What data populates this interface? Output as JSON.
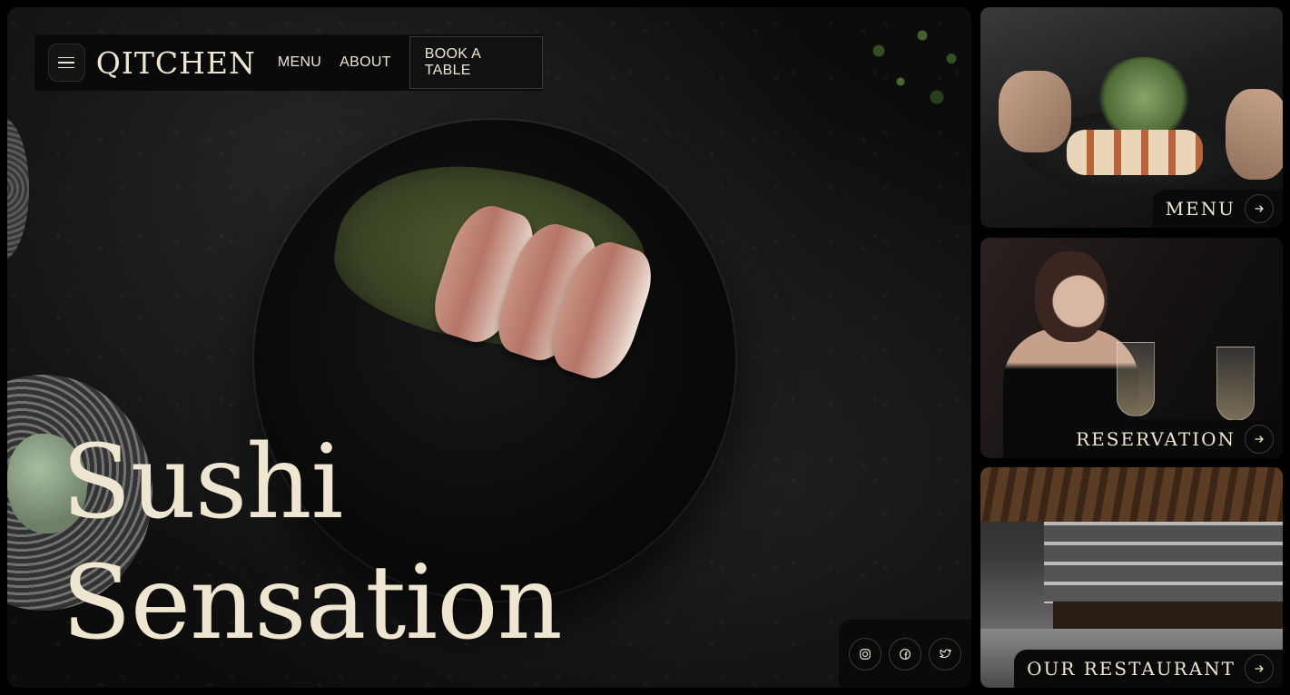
{
  "brand": {
    "logo": "QITCHEN"
  },
  "nav": {
    "menu_label": "MENU",
    "about_label": "ABOUT",
    "book_label": "BOOK A TABLE"
  },
  "hero": {
    "line1": "Sushi",
    "line2": "Sensation"
  },
  "social": {
    "items": [
      "instagram-icon",
      "facebook-icon",
      "twitter-icon"
    ]
  },
  "cards": [
    {
      "label": "MENU"
    },
    {
      "label": "RESERVATION"
    },
    {
      "label": "OUR RESTAURANT"
    }
  ],
  "colors": {
    "text": "#efe6d2",
    "background": "#000000",
    "panel": "#0a0a0a"
  }
}
